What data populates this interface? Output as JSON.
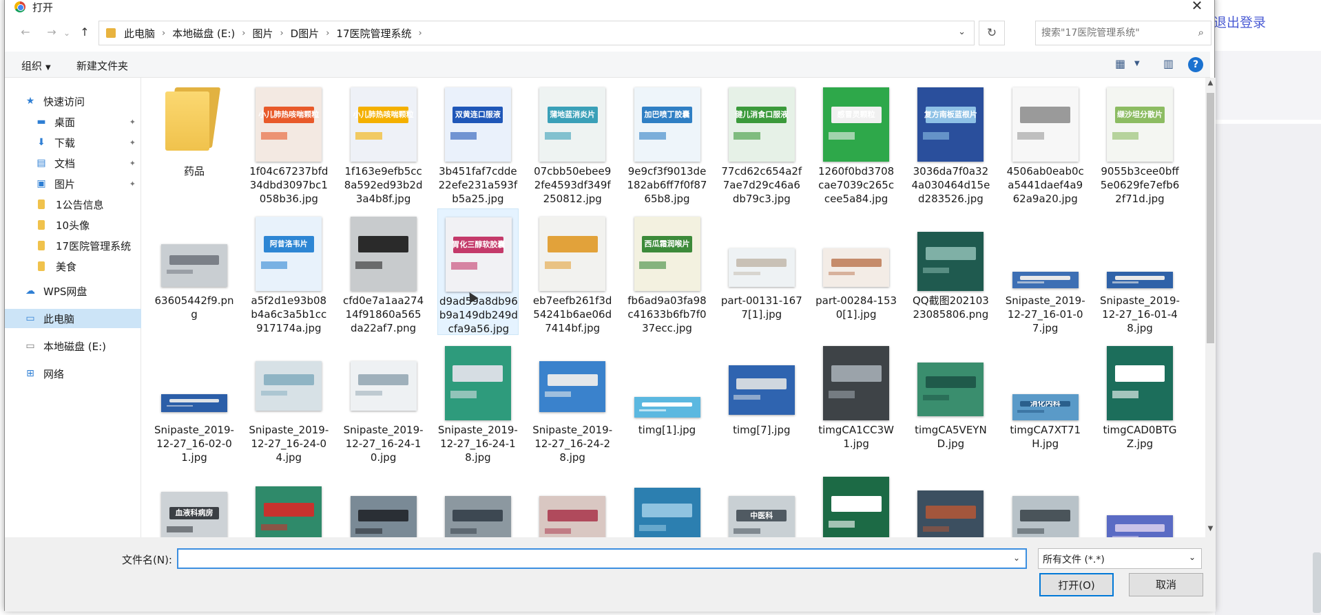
{
  "dialog": {
    "title": "打开",
    "close_label": "✕"
  },
  "nav": {
    "back": "←",
    "forward": "→",
    "dropdown": "⌄",
    "up": "↑",
    "breadcrumbs": [
      "此电脑",
      "本地磁盘 (E:)",
      "图片",
      "D图片",
      "17医院管理系统"
    ],
    "search_placeholder": "搜索\"17医院管理系统\""
  },
  "toolbar": {
    "organize": "组织",
    "new_folder": "新建文件夹"
  },
  "sidebar": {
    "quick_access": "快速访问",
    "items": [
      {
        "label": "桌面",
        "pinned": true
      },
      {
        "label": "下载",
        "pinned": true
      },
      {
        "label": "文档",
        "pinned": true
      },
      {
        "label": "图片",
        "pinned": true
      },
      {
        "label": "1公告信息",
        "pinned": false
      },
      {
        "label": "10头像",
        "pinned": false
      },
      {
        "label": "17医院管理系统",
        "pinned": false
      },
      {
        "label": "美食",
        "pinned": false
      }
    ],
    "wps": "WPS网盘",
    "this_pc": "此电脑",
    "local_disk": "本地磁盘 (E:)",
    "network": "网络"
  },
  "files": [
    {
      "name": "药品"
    },
    {
      "name": "1f04c67237bfd34dbd3097bc1058b36.jpg",
      "thumb": "#f3e9e2",
      "accent": "#e85a2a"
    },
    {
      "name": "1f163e9efb5cc8a592ed93b2d3a4b8f.jpg",
      "thumb": "#eef1f7",
      "accent": "#f4b000"
    },
    {
      "name": "3b451faf7cdde22efe231a593fb5a25.jpg",
      "thumb": "#eaf1fb",
      "accent": "#1f57b8"
    },
    {
      "name": "07cbb50ebee92fe4593df349f250812.jpg",
      "thumb": "#eef3f2",
      "accent": "#3aa0b8"
    },
    {
      "name": "9e9cf3f9013de182ab6ff7f0f8765b8.jpg",
      "thumb": "#eef5fa",
      "accent": "#2f7fc4"
    },
    {
      "name": "77cd62c654a2f7ae7d29c46a6db79c3.jpg",
      "thumb": "#e6f1e7",
      "accent": "#3b9a3b"
    },
    {
      "name": "1260f0bd3708cae7039c265ccee5a84.jpg",
      "thumb": "#2ea84a",
      "accent": "#f0f0f0"
    },
    {
      "name": "3036da7f0a324a030464d15ed283526.jpg",
      "thumb": "#2a4f9c",
      "accent": "#8ec1e6"
    },
    {
      "name": "4506ab0eab0ca5441daef4a962a9a20.jpg",
      "thumb": "#f7f7f7",
      "accent": "#9a9a9a"
    },
    {
      "name": "9055b3cee0bff5e0629fe7efb62f71d.jpg",
      "thumb": "#f4f6f2",
      "accent": "#8cbc62"
    },
    {
      "name": "63605442f9.png",
      "thumb": "#c9ced2",
      "accent": "#7b8088"
    },
    {
      "name": "a5f2d1e93b08b4a6c3a5b1cc917174a.jpg",
      "thumb": "#e8f2fb",
      "accent": "#2d86d4"
    },
    {
      "name": "cfd0e7a1aa27414f91860a565da22af7.png",
      "thumb": "#c8cbcd",
      "accent": "#2a2a2a"
    },
    {
      "name": "d9ad59a8db96b9a149db249dcfa9a56.jpg",
      "thumb": "#f1f1f4",
      "accent": "#c43a6a"
    },
    {
      "name": "eb7eefb261f3d54241b6ae06d7414bf.jpg",
      "thumb": "#f2f2ef",
      "accent": "#e2a23a"
    },
    {
      "name": "fb6ad9a03fa98c41633b6fb7f037ecc.jpg",
      "thumb": "#f3f1e0",
      "accent": "#3c8a3a"
    },
    {
      "name": "part-00131-1677[1].jpg",
      "thumb": "#eef2f4",
      "accent": "#c9c1b6"
    },
    {
      "name": "part-00284-1530[1].jpg",
      "thumb": "#f3ece6",
      "accent": "#c58b6a"
    },
    {
      "name": "QQ截图20210323085806.png",
      "thumb": "#1f5a4f",
      "accent": "#7fb0a6"
    },
    {
      "name": "Snipaste_2019-12-27_16-01-07.jpg",
      "thumb": "#3d6fb4",
      "accent": "#e9e9e9"
    },
    {
      "name": "Snipaste_2019-12-27_16-01-48.jpg",
      "thumb": "#2f62a8",
      "accent": "#e9e9e9"
    },
    {
      "name": "Snipaste_2019-12-27_16-02-01.jpg",
      "thumb": "#2b5ea8",
      "accent": "#dfe3e8"
    },
    {
      "name": "Snipaste_2019-12-27_16-24-04.jpg",
      "thumb": "#d7e1e6",
      "accent": "#8fb4c4"
    },
    {
      "name": "Snipaste_2019-12-27_16-24-10.jpg",
      "thumb": "#eef1f3",
      "accent": "#9fb0bb"
    },
    {
      "name": "Snipaste_2019-12-27_16-24-18.jpg",
      "thumb": "#2e9b7c",
      "accent": "#d6dde3"
    },
    {
      "name": "Snipaste_2019-12-27_16-24-28.jpg",
      "thumb": "#3a82cc",
      "accent": "#e3e7ea"
    },
    {
      "name": "timg[1].jpg",
      "thumb": "#5bb8e0",
      "accent": "#ffffff"
    },
    {
      "name": "timg[7].jpg",
      "thumb": "#2f64b0",
      "accent": "#d0d7df"
    },
    {
      "name": "timgCA1CC3W1.jpg",
      "thumb": "#3e4347",
      "accent": "#9ba3aa"
    },
    {
      "name": "timgCA5VEYND.jpg",
      "thumb": "#3a8e6e",
      "accent": "#1f5a4a"
    },
    {
      "name": "timgCA7XT71H.jpg",
      "thumb": "#5a9ac8",
      "accent": "#2a5f8c"
    },
    {
      "name": "timgCAD0BTGZ.jpg",
      "thumb": "#1c6e5b",
      "accent": "#ffffff"
    },
    {
      "name": "",
      "thumb": "#cdd2d6",
      "accent": "#3b3f44"
    },
    {
      "name": "",
      "thumb": "#2f8a6a",
      "accent": "#c8322e"
    },
    {
      "name": "",
      "thumb": "#7a8a96",
      "accent": "#2a2f35"
    },
    {
      "name": "",
      "thumb": "#8c98a0",
      "accent": "#3d4852"
    },
    {
      "name": "",
      "thumb": "#d9c7c2",
      "accent": "#b04a5c"
    },
    {
      "name": "",
      "thumb": "#2c7fb0",
      "accent": "#8fc3e0"
    },
    {
      "name": "",
      "thumb": "#c9d0d4",
      "accent": "#505a62"
    },
    {
      "name": "",
      "thumb": "#1c6a45",
      "accent": "#ffffff"
    },
    {
      "name": "",
      "thumb": "#3c4f60",
      "accent": "#a3563c"
    },
    {
      "name": "",
      "thumb": "#b8c2c8",
      "accent": "#4a545a"
    },
    {
      "name": "",
      "thumb": "#5a6bc4",
      "accent": "#c9c2e8"
    }
  ],
  "thumb_labels": {
    "t1": "小儿肺热咳喘颗粒",
    "t2": "小儿肺热咳喘颗粒",
    "t3": "双黄连口服液",
    "t4": "蒲地蓝消炎片",
    "t5": "加巴喷丁胶囊",
    "t6": "健儿消食口服液",
    "t7": "感冒灵颗粒",
    "t8": "复方南板蓝根片",
    "t10": "缬沙坦分散片",
    "t12": "阿昔洛韦片",
    "t14": "胃化三醇软胶囊",
    "t16": "西瓜霜润喉片",
    "t31": "消化内科",
    "t33": "血液科病房",
    "t39": "中医科"
  },
  "bottom": {
    "filename_label": "文件名(N):",
    "filename_value": "",
    "filetype": "所有文件 (*.*)",
    "open": "打开(O)",
    "cancel": "取消"
  },
  "background": {
    "logout": "退出登录"
  }
}
